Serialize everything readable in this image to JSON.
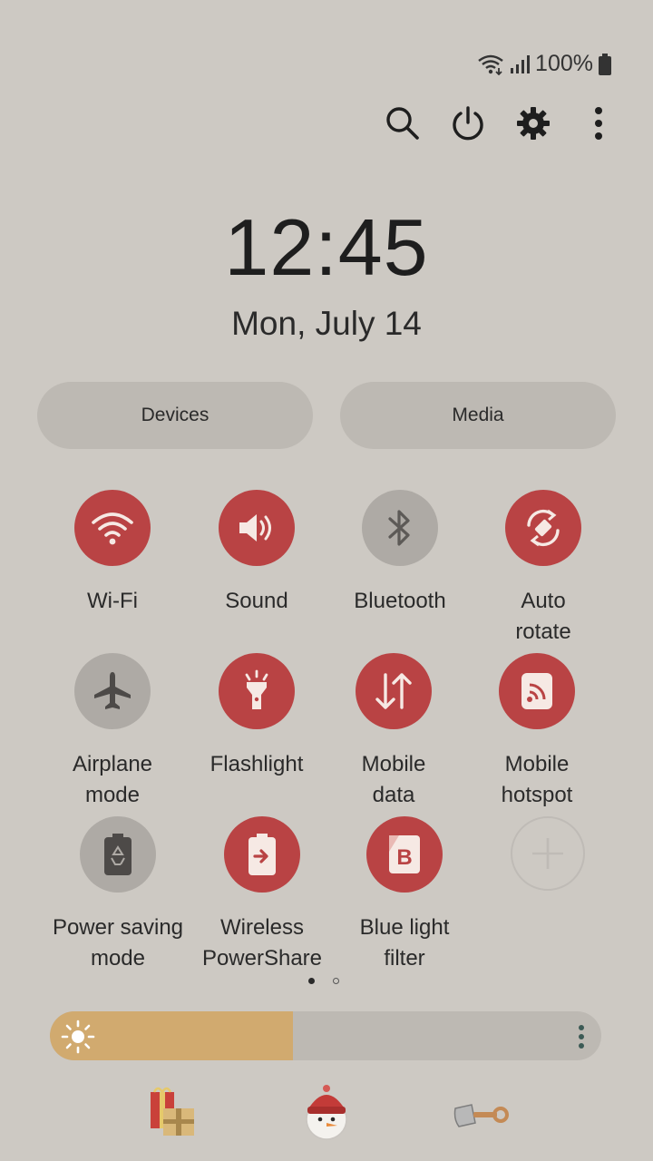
{
  "status": {
    "battery_text": "100%"
  },
  "top_actions": [
    "search-icon",
    "power-icon",
    "gear-icon",
    "more-vertical-icon"
  ],
  "clock": {
    "time": "12:45",
    "date": "Mon, July 14"
  },
  "pills": {
    "devices": "Devices",
    "media": "Media"
  },
  "tiles": [
    {
      "label_lines": [
        "Wi-Fi"
      ],
      "state": "on",
      "icon": "wifi-icon"
    },
    {
      "label_lines": [
        "Sound"
      ],
      "state": "on",
      "icon": "sound-icon"
    },
    {
      "label_lines": [
        "Bluetooth"
      ],
      "state": "off",
      "icon": "bluetooth-icon"
    },
    {
      "label_lines": [
        "Auto",
        "rotate"
      ],
      "state": "on",
      "icon": "auto-rotate-icon"
    },
    {
      "label_lines": [
        "Airplane",
        "mode"
      ],
      "state": "off",
      "icon": "airplane-icon"
    },
    {
      "label_lines": [
        "Flashlight"
      ],
      "state": "on",
      "icon": "flashlight-icon"
    },
    {
      "label_lines": [
        "Mobile",
        "data"
      ],
      "state": "on",
      "icon": "mobile-data-icon"
    },
    {
      "label_lines": [
        "Mobile",
        "hotspot"
      ],
      "state": "on",
      "icon": "hotspot-icon"
    },
    {
      "label_lines": [
        "Power saving",
        "mode"
      ],
      "state": "off",
      "icon": "battery-saver-icon"
    },
    {
      "label_lines": [
        "Wireless",
        "PowerShare"
      ],
      "state": "on",
      "icon": "powershare-icon"
    },
    {
      "label_lines": [
        "Blue light",
        "filter"
      ],
      "state": "on",
      "icon": "blue-light-icon"
    },
    {
      "label_lines": [
        ""
      ],
      "state": "add",
      "icon": "add-icon"
    }
  ],
  "page_indicator": {
    "current": 1,
    "total": 2
  },
  "brightness": {
    "level": 0.44,
    "accent": "#d1aa6f"
  },
  "colors": {
    "background": "#cdc9c3",
    "tile_on": "#b94344",
    "tile_off": "#aeaaa5"
  },
  "bottom_icons": [
    "gifts-icon",
    "snowman-icon",
    "shovel-icon"
  ]
}
